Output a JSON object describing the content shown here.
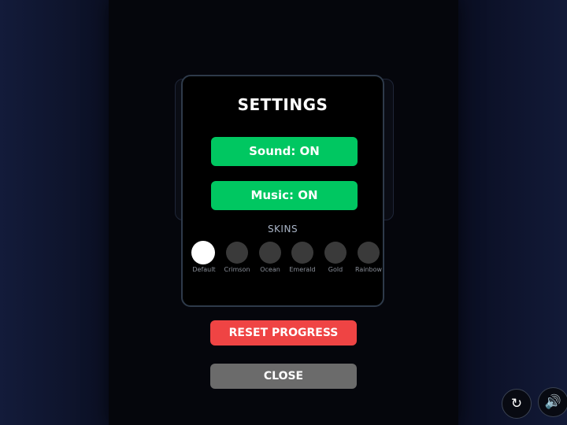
{
  "settings": {
    "title": "SETTINGS",
    "sound_label": "Sound: ON",
    "music_label": "Music: ON",
    "skins_heading": "SKINS",
    "skins": [
      {
        "label": "Default",
        "color": "#ffffff",
        "selected": true
      },
      {
        "label": "Crimson",
        "color": "#3a3a3a",
        "selected": false
      },
      {
        "label": "Ocean",
        "color": "#3a3a3a",
        "selected": false
      },
      {
        "label": "Emerald",
        "color": "#3a3a3a",
        "selected": false
      },
      {
        "label": "Gold",
        "color": "#3a3a3a",
        "selected": false
      },
      {
        "label": "Rainbow",
        "color": "#3a3a3a",
        "selected": false
      }
    ]
  },
  "actions": {
    "reset_label": "RESET PROGRESS",
    "close_label": "CLOSE"
  },
  "corner": {
    "restart_icon": "↻",
    "audio_icon": "🔊"
  },
  "colors": {
    "toggle_on": "#00c761",
    "reset": "#ef4444",
    "close": "#6b6b6b"
  }
}
